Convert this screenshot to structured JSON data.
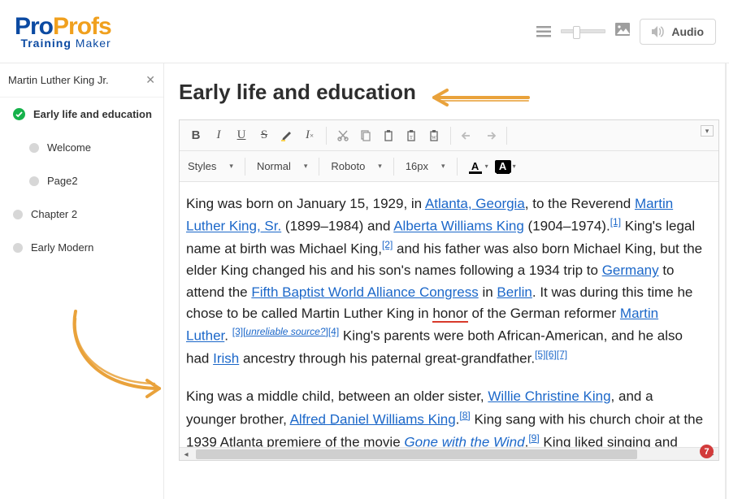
{
  "logo": {
    "pro": "Pro",
    "profs": "Profs",
    "sub1": "Training",
    "sub2": "Maker"
  },
  "header": {
    "audio_label": "Audio"
  },
  "sidebar": {
    "title": "Martin Luther King Jr.",
    "items": [
      {
        "label": "Early life and education"
      },
      {
        "label": "Welcome"
      },
      {
        "label": "Page2"
      },
      {
        "label": "Chapter 2"
      },
      {
        "label": "Early Modern"
      }
    ]
  },
  "page": {
    "title": "Early life and education"
  },
  "toolbar": {
    "styles": "Styles",
    "format": "Normal",
    "font": "Roboto",
    "size": "16px"
  },
  "body": {
    "p1a": "King was born on January 15, 1929, in ",
    "link_atlanta": "Atlanta, Georgia",
    "p1b": ", to the Reverend ",
    "link_mlk_sr": "Martin Luther King, Sr.",
    "p1c": " (1899–1984) and ",
    "link_alberta": "Alberta Williams King",
    "p1d": " (1904–1974).",
    "ref1": "[1]",
    "p1e": " King's legal name at birth was Michael King,",
    "ref2": "[2]",
    "p1f": " and his father was also born Michael King, but the elder King changed his and his son's names following a 1934 trip to ",
    "link_germany": "Germany",
    "p1g": " to attend the ",
    "link_congress": "Fifth Baptist World Alliance Congress",
    "p1h": " in ",
    "link_berlin": "Berlin",
    "p1i": ". It was during this time he chose to be called Martin Luther King in ",
    "honor": "honor",
    "p1j": " of the German reformer ",
    "link_ml": "Martin Luther",
    "p1k": ".",
    "ref3": "[3]",
    "bracket_open": "[",
    "unrel": "unreliable source?",
    "bracket_close": "]",
    "ref4": "[4]",
    "p1l": "  King's parents were both African-American, and he also had ",
    "link_irish": "Irish",
    "p1m": " ancestry through his paternal great-grandfather.",
    "ref5": "[5]",
    "ref6": "[6]",
    "ref7": "[7]",
    "p2a": "King was a middle child, between an older sister, ",
    "link_willie": "Willie Christine King",
    "p2b": ", and a younger brother, ",
    "link_alfred": "Alfred Daniel Williams King",
    "p2c": ".",
    "ref8": "[8]",
    "p2d": " King sang with his church choir at the 1939 Atlanta premiere of the movie ",
    "link_gone": "Gone with the Wind",
    "p2e": ".",
    "ref9": "[9]",
    "p2f": " King liked singing and music."
  },
  "badge": {
    "count": "7"
  }
}
